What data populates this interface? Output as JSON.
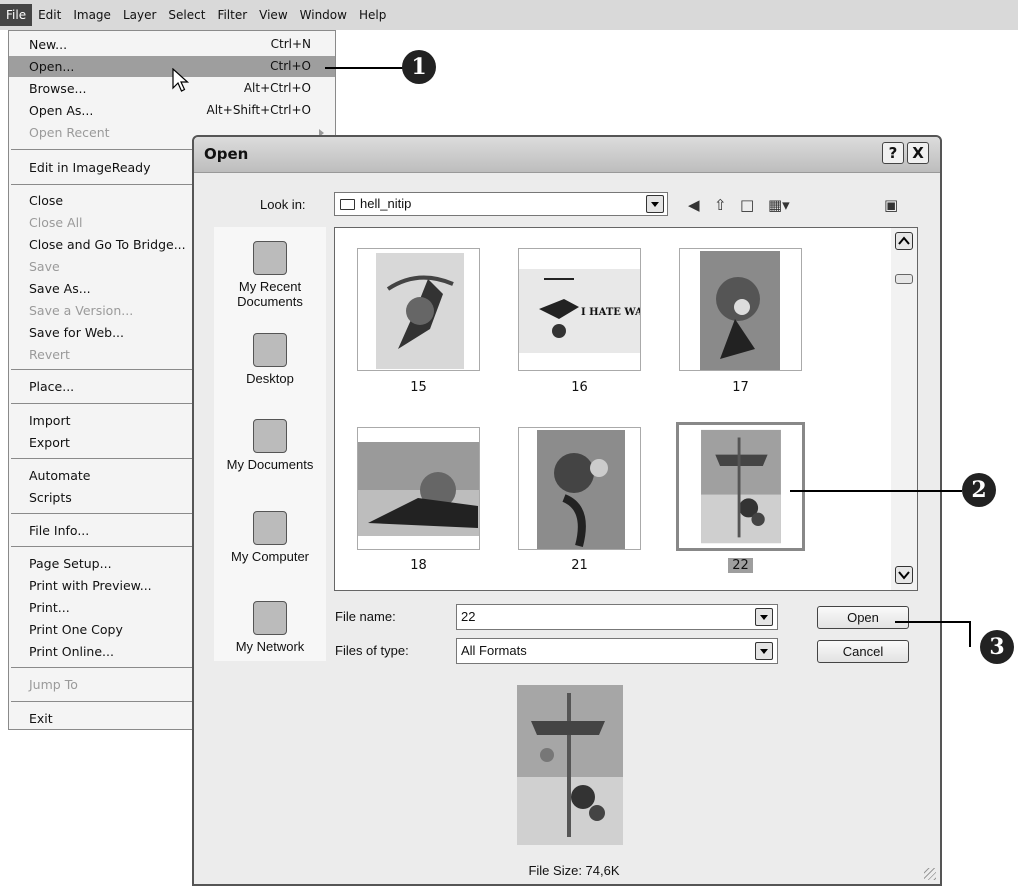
{
  "menubar": {
    "items": [
      "File",
      "Edit",
      "Image",
      "Layer",
      "Select",
      "Filter",
      "View",
      "Window",
      "Help"
    ]
  },
  "file_menu": {
    "items": [
      {
        "label": "New...",
        "shortcut": "Ctrl+N"
      },
      {
        "label": "Open...",
        "shortcut": "Ctrl+O"
      },
      {
        "label": "Browse...",
        "shortcut": "Alt+Ctrl+O"
      },
      {
        "label": "Open As...",
        "shortcut": "Alt+Shift+Ctrl+O"
      },
      {
        "label": "Open Recent",
        "shortcut": ""
      },
      {
        "label": "Edit in ImageReady",
        "shortcut": ""
      },
      {
        "label": "Close",
        "shortcut": ""
      },
      {
        "label": "Close All",
        "shortcut": ""
      },
      {
        "label": "Close and Go To Bridge...",
        "shortcut": ""
      },
      {
        "label": "Save",
        "shortcut": ""
      },
      {
        "label": "Save As...",
        "shortcut": ""
      },
      {
        "label": "Save a Version...",
        "shortcut": ""
      },
      {
        "label": "Save for Web...",
        "shortcut": ""
      },
      {
        "label": "Revert",
        "shortcut": ""
      },
      {
        "label": "Place...",
        "shortcut": ""
      },
      {
        "label": "Import",
        "shortcut": ""
      },
      {
        "label": "Export",
        "shortcut": ""
      },
      {
        "label": "Automate",
        "shortcut": ""
      },
      {
        "label": "Scripts",
        "shortcut": ""
      },
      {
        "label": "File Info...",
        "shortcut": ""
      },
      {
        "label": "Page Setup...",
        "shortcut": ""
      },
      {
        "label": "Print with Preview...",
        "shortcut": ""
      },
      {
        "label": "Print...",
        "shortcut": ""
      },
      {
        "label": "Print One Copy",
        "shortcut": ""
      },
      {
        "label": "Print Online...",
        "shortcut": ""
      },
      {
        "label": "Jump To",
        "shortcut": ""
      },
      {
        "label": "Exit",
        "shortcut": ""
      }
    ]
  },
  "callouts": [
    "1",
    "2",
    "3"
  ],
  "dialog": {
    "title": "Open",
    "help_button": "?",
    "close_button": "X",
    "look_in_label": "Look in:",
    "look_in_value": "hell_nitip",
    "places": [
      "My Recent Documents",
      "Desktop",
      "My Documents",
      "My Computer",
      "My Network"
    ],
    "files": [
      "15",
      "16",
      "17",
      "18",
      "21",
      "22"
    ],
    "thumb_16_text": "I HATE WAR",
    "selected_file": "22",
    "file_name_label": "File name:",
    "file_name_value": "22",
    "file_type_label": "Files of type:",
    "file_type_value": "All Formats",
    "open_button": "Open",
    "cancel_button": "Cancel",
    "file_size": "File Size: 74,6K"
  }
}
